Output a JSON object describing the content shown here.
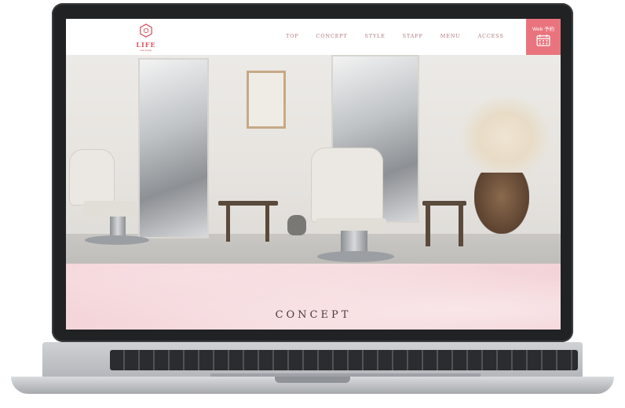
{
  "brand": {
    "logo_text": "LIFE",
    "logo_sub": "hair design",
    "accent_color": "#d9535f"
  },
  "nav": {
    "items": [
      "TOP",
      "CONCEPT",
      "STYLE",
      "STAFF",
      "MENU",
      "ACCESS"
    ]
  },
  "web_reservation": {
    "label": "Web 予約",
    "icon": "calendar-icon",
    "color": "#e9747d"
  },
  "hero": {
    "image_subject": "salon-interior"
  },
  "concept": {
    "title": "CONCEPT"
  }
}
